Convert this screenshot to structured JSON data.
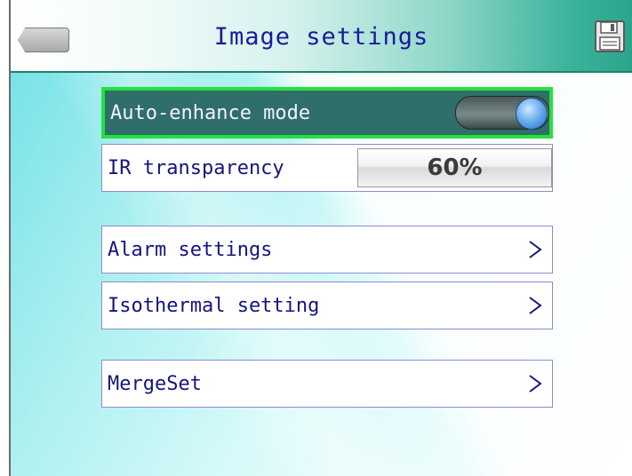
{
  "header": {
    "title": "Image settings",
    "back_icon": "back-arrow-icon",
    "save_icon": "floppy-save-icon"
  },
  "settings": {
    "auto_enhance": {
      "label": "Auto-enhance mode",
      "enabled": true
    },
    "ir_transparency": {
      "label": "IR transparency",
      "value": "60%"
    },
    "alarm": {
      "label": "Alarm settings",
      "chevron": ">"
    },
    "isothermal": {
      "label": "Isothermal setting",
      "chevron": ">"
    },
    "mergeset": {
      "label": "MergeSet",
      "chevron": ">"
    }
  },
  "colors": {
    "title_text": "#1b1b9a",
    "selection_border": "#23e23a",
    "selected_row_bg": "#2f6e6a",
    "header_gradient_end": "#2aa68c"
  }
}
